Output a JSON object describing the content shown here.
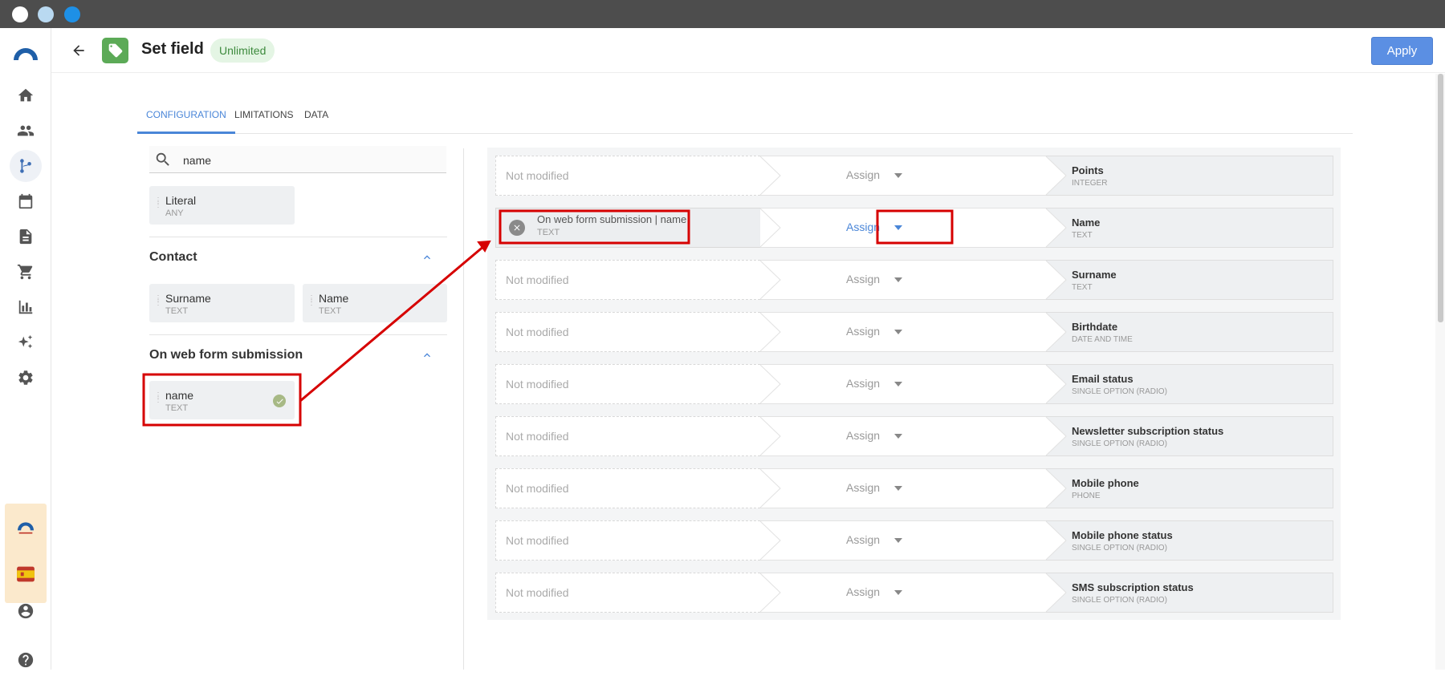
{
  "header": {
    "title": "Set field",
    "badge": "Unlimited",
    "apply_label": "Apply"
  },
  "tabs": [
    {
      "label": "Configuration",
      "active": true
    },
    {
      "label": "Limitations",
      "active": false
    },
    {
      "label": "Data",
      "active": false
    }
  ],
  "search": {
    "value": "name"
  },
  "literal": {
    "name": "Literal",
    "type": "ANY"
  },
  "sections": [
    {
      "title": "Contact",
      "items": [
        {
          "name": "Surname",
          "type": "TEXT"
        },
        {
          "name": "Name",
          "type": "TEXT"
        }
      ]
    },
    {
      "title": "On web form submission",
      "items": [
        {
          "name": "name",
          "type": "TEXT"
        }
      ]
    }
  ],
  "mapping_rows": [
    {
      "source": "Not modified",
      "source_type": "",
      "operation": "Assign",
      "field": "Points",
      "field_type": "INTEGER"
    },
    {
      "source": "On web form submission | name",
      "source_type": "TEXT",
      "operation": "Assign",
      "field": "Name",
      "field_type": "TEXT"
    },
    {
      "source": "Not modified",
      "source_type": "",
      "operation": "Assign",
      "field": "Surname",
      "field_type": "TEXT"
    },
    {
      "source": "Not modified",
      "source_type": "",
      "operation": "Assign",
      "field": "Birthdate",
      "field_type": "DATE AND TIME"
    },
    {
      "source": "Not modified",
      "source_type": "",
      "operation": "Assign",
      "field": "Email status",
      "field_type": "SINGLE OPTION (RADIO)"
    },
    {
      "source": "Not modified",
      "source_type": "",
      "operation": "Assign",
      "field": "Newsletter subscription status",
      "field_type": "SINGLE OPTION (RADIO)"
    },
    {
      "source": "Not modified",
      "source_type": "",
      "operation": "Assign",
      "field": "Mobile phone",
      "field_type": "PHONE"
    },
    {
      "source": "Not modified",
      "source_type": "",
      "operation": "Assign",
      "field": "Mobile phone status",
      "field_type": "SINGLE OPTION (RADIO)"
    },
    {
      "source": "Not modified",
      "source_type": "",
      "operation": "Assign",
      "field": "SMS subscription status",
      "field_type": "SINGLE OPTION (RADIO)"
    }
  ],
  "sidebar": {
    "items": [
      {
        "icon": "home-icon"
      },
      {
        "icon": "contacts-icon"
      },
      {
        "icon": "automation-icon",
        "active": true
      },
      {
        "icon": "calendar-icon"
      },
      {
        "icon": "document-icon"
      },
      {
        "icon": "cart-icon"
      },
      {
        "icon": "chart-icon"
      },
      {
        "icon": "sparkle-icon"
      },
      {
        "icon": "gear-icon"
      },
      {
        "icon": "user-icon"
      },
      {
        "icon": "help-icon"
      }
    ]
  },
  "colors": {
    "accent": "#4a86d8",
    "highlight": "#e00000",
    "tag_green": "#5caa57"
  }
}
